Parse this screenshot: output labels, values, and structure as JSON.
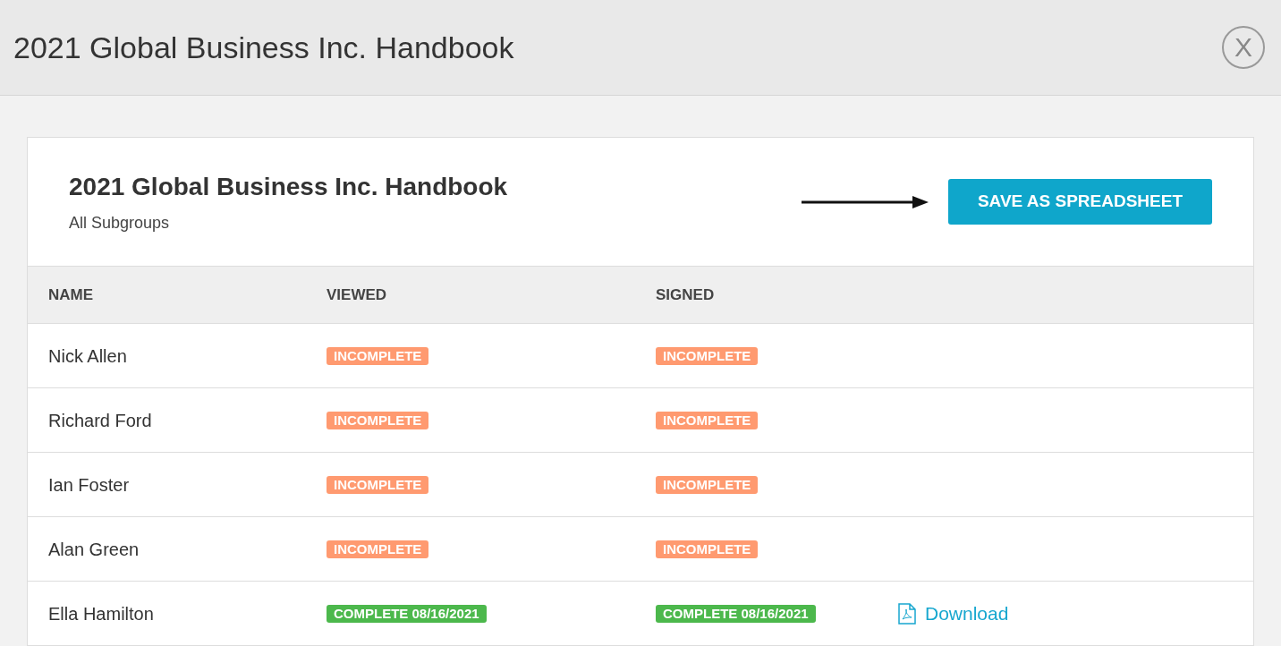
{
  "window": {
    "title": "2021 Global Business Inc. Handbook",
    "close_label": "X"
  },
  "card": {
    "title": "2021 Global Business Inc. Handbook",
    "subtitle": "All Subgroups",
    "button": "SAVE AS SPREADSHEET"
  },
  "table": {
    "columns": [
      "NAME",
      "VIEWED",
      "SIGNED"
    ],
    "rows": [
      {
        "name": "Nick Allen",
        "viewed": {
          "kind": "incomplete",
          "text": "INCOMPLETE"
        },
        "signed": {
          "kind": "incomplete",
          "text": "INCOMPLETE"
        }
      },
      {
        "name": "Richard Ford",
        "viewed": {
          "kind": "incomplete",
          "text": "INCOMPLETE"
        },
        "signed": {
          "kind": "incomplete",
          "text": "INCOMPLETE"
        }
      },
      {
        "name": "Ian Foster",
        "viewed": {
          "kind": "incomplete",
          "text": "INCOMPLETE"
        },
        "signed": {
          "kind": "incomplete",
          "text": "INCOMPLETE"
        }
      },
      {
        "name": "Alan Green",
        "viewed": {
          "kind": "incomplete",
          "text": "INCOMPLETE"
        },
        "signed": {
          "kind": "incomplete",
          "text": "INCOMPLETE"
        }
      },
      {
        "name": "Ella Hamilton",
        "viewed": {
          "kind": "complete",
          "text": "COMPLETE 08/16/2021"
        },
        "signed": {
          "kind": "complete",
          "text": "COMPLETE 08/16/2021"
        },
        "download": "Download"
      }
    ]
  }
}
